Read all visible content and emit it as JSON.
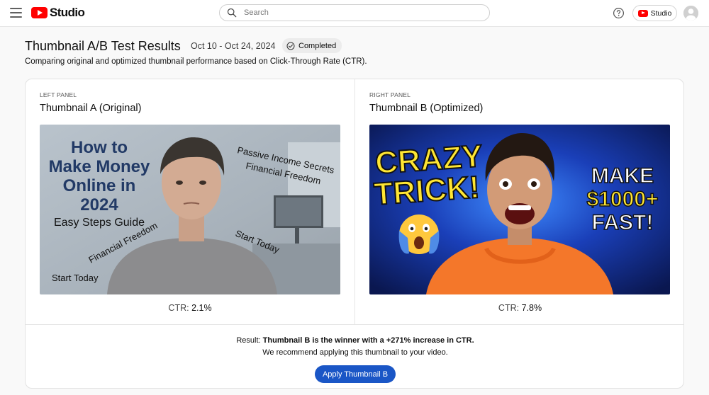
{
  "topbar": {
    "logo_text": "Studio",
    "search_placeholder": "Search",
    "studio_button_label": "Studio"
  },
  "header": {
    "title": "Thumbnail A/B Test Results",
    "date_range": "Oct 10 - Oct 24, 2024",
    "status": "Completed",
    "subtitle": "Comparing original and optimized thumbnail performance based on Click-Through Rate (CTR)."
  },
  "panels": [
    {
      "kicker": "LEFT PANEL",
      "title": "Thumbnail A (Original)",
      "ctr_label": "CTR:",
      "ctr_value": "2.1%",
      "thumb_text": {
        "line1": "How to",
        "line2": "Make Money",
        "line3": "Online in",
        "line4": "2024",
        "line5": "Easy Steps Guide",
        "tag1": "Passive Income Secrets",
        "tag2": "Financial Freedom",
        "tag3": "Start Today",
        "tag4": "Financial Freedom",
        "tag5": "Start Today"
      }
    },
    {
      "kicker": "RIGHT PANEL",
      "title": "Thumbnail B (Optimized)",
      "ctr_label": "CTR:",
      "ctr_value": "7.8%",
      "thumb_text": {
        "crazy": "CRAZY",
        "trick": "TRICK!",
        "make": "MAKE",
        "amount": "$1000+",
        "fast": "FAST!"
      }
    }
  ],
  "result": {
    "prefix": "Result:",
    "statement": "Thumbnail B is the winner with a +271% increase in CTR.",
    "recommendation": "We recommend applying this thumbnail to your video.",
    "apply_label": "Apply Thumbnail B"
  },
  "colors": {
    "brand_red": "#ff0000",
    "primary_button": "#1a56c6",
    "badge_bg": "#ececec"
  },
  "icons": [
    "menu-icon",
    "youtube-logo-icon",
    "search-icon",
    "help-icon",
    "check-circle-icon",
    "avatar-icon",
    "shocked-face-emoji-icon"
  ]
}
